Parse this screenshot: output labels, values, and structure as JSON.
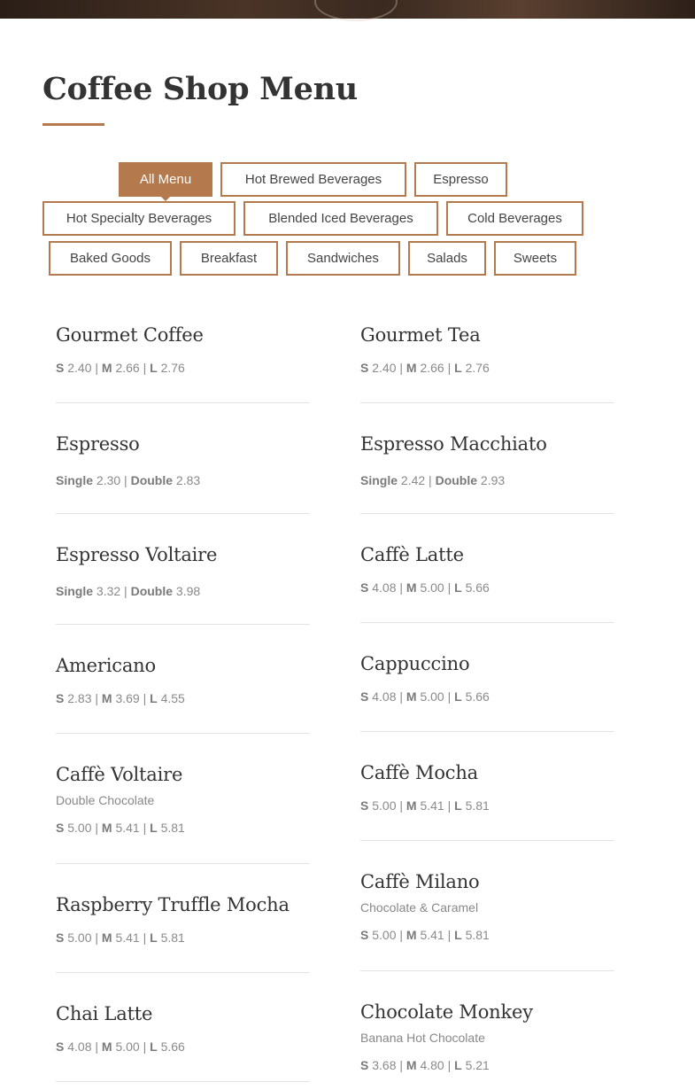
{
  "page": {
    "title": "Coffee Shop Menu"
  },
  "colors": {
    "accent": "#b47a4e",
    "divider": "#e3e3e3"
  },
  "tabs": [
    {
      "label": "All Menu",
      "active": true
    },
    {
      "label": "Hot Brewed Beverages"
    },
    {
      "label": "Espresso"
    },
    {
      "label": "Hot Specialty Beverages"
    },
    {
      "label": "Blended Iced Beverages"
    },
    {
      "label": "Cold Beverages"
    },
    {
      "label": "Baked Goods"
    },
    {
      "label": "Breakfast"
    },
    {
      "label": "Sandwiches"
    },
    {
      "label": "Salads"
    },
    {
      "label": "Sweets"
    }
  ],
  "menu": {
    "left": [
      {
        "name": "Gourmet Coffee",
        "prices": [
          {
            "size": "S",
            "price": "2.40"
          },
          {
            "size": "M",
            "price": "2.66"
          },
          {
            "size": "L",
            "price": "2.76"
          }
        ]
      },
      {
        "name": "Espresso",
        "prices": [
          {
            "size": "Single",
            "price": "2.30"
          },
          {
            "size": "Double",
            "price": "2.83"
          }
        ]
      },
      {
        "name": "Espresso Voltaire",
        "prices": [
          {
            "size": "Single",
            "price": "3.32"
          },
          {
            "size": "Double",
            "price": "3.98"
          }
        ]
      },
      {
        "name": "Americano",
        "prices": [
          {
            "size": "S",
            "price": "2.83"
          },
          {
            "size": "M",
            "price": "3.69"
          },
          {
            "size": "L",
            "price": "4.55"
          }
        ]
      },
      {
        "name": "Caffè Voltaire",
        "description": "Double Chocolate",
        "prices": [
          {
            "size": "S",
            "price": "5.00"
          },
          {
            "size": "M",
            "price": "5.41"
          },
          {
            "size": "L",
            "price": "5.81"
          }
        ]
      },
      {
        "name": "Raspberry Truffle Mocha",
        "prices": [
          {
            "size": "S",
            "price": "5.00"
          },
          {
            "size": "M",
            "price": "5.41"
          },
          {
            "size": "L",
            "price": "5.81"
          }
        ]
      },
      {
        "name": "Chai Latte",
        "prices": [
          {
            "size": "S",
            "price": "4.08"
          },
          {
            "size": "M",
            "price": "5.00"
          },
          {
            "size": "L",
            "price": "5.66"
          }
        ]
      }
    ],
    "right": [
      {
        "name": "Gourmet Tea",
        "prices": [
          {
            "size": "S",
            "price": "2.40"
          },
          {
            "size": "M",
            "price": "2.66"
          },
          {
            "size": "L",
            "price": "2.76"
          }
        ]
      },
      {
        "name": "Espresso Macchiato",
        "prices": [
          {
            "size": "Single",
            "price": "2.42"
          },
          {
            "size": "Double",
            "price": "2.93"
          }
        ]
      },
      {
        "name": "Caffè Latte",
        "prices": [
          {
            "size": "S",
            "price": "4.08"
          },
          {
            "size": "M",
            "price": "5.00"
          },
          {
            "size": "L",
            "price": "5.66"
          }
        ]
      },
      {
        "name": "Cappuccino",
        "prices": [
          {
            "size": "S",
            "price": "4.08"
          },
          {
            "size": "M",
            "price": "5.00"
          },
          {
            "size": "L",
            "price": "5.66"
          }
        ]
      },
      {
        "name": "Caffè Mocha",
        "prices": [
          {
            "size": "S",
            "price": "5.00"
          },
          {
            "size": "M",
            "price": "5.41"
          },
          {
            "size": "L",
            "price": "5.81"
          }
        ]
      },
      {
        "name": "Caffè Milano",
        "description": "Chocolate & Caramel",
        "prices": [
          {
            "size": "S",
            "price": "5.00"
          },
          {
            "size": "M",
            "price": "5.41"
          },
          {
            "size": "L",
            "price": "5.81"
          }
        ]
      },
      {
        "name": "Chocolate Monkey",
        "description": "Banana Hot Chocolate",
        "prices": [
          {
            "size": "S",
            "price": "3.68"
          },
          {
            "size": "M",
            "price": "4.80"
          },
          {
            "size": "L",
            "price": "5.21"
          }
        ]
      }
    ]
  }
}
